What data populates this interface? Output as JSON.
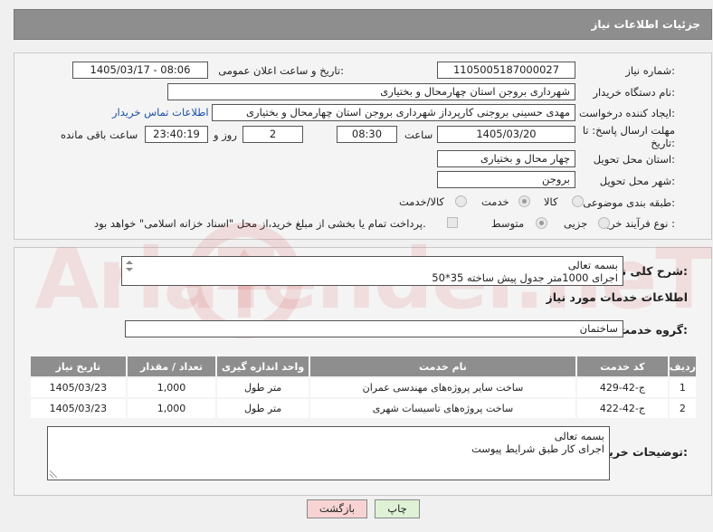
{
  "header": {
    "title": "جزئیات اطلاعات نیاز"
  },
  "fields": {
    "need_number_label": "شماره نیاز:",
    "need_number": "1105005187000027",
    "announce_label": "تاریخ و ساعت اعلان عمومی:",
    "announce_value": "1405/03/17 - 08:06",
    "buyer_org_label": "نام دستگاه خریدار:",
    "buyer_org": "شهرداری بروجن استان چهارمحال و بختیاری",
    "requester_label": "ایجاد کننده درخواست:",
    "requester": "مهدی حسینی بروجنی کارپرداز شهرداری بروجن استان چهارمحال و بختیاری",
    "contact_link": "اطلاعات تماس خریدار",
    "deadline_label": "مهلت ارسال پاسخ: تا تاریخ:",
    "deadline_date": "1405/03/20",
    "time_label": "ساعت",
    "deadline_time": "08:30",
    "days_value": "2",
    "days_label": "روز و",
    "remaining_time": "23:40:19",
    "remaining_label": "ساعت باقی مانده",
    "province_label": "استان محل تحویل:",
    "province": "چهار محال و بختیاری",
    "city_label": "شهر محل تحویل:",
    "city": "بروجن",
    "category_label": "طبقه بندی موضوعی:",
    "category_options": [
      "کالا",
      "خدمت",
      "کالا/خدمت"
    ],
    "category_selected": "خدمت",
    "process_label": "نوع فرآیند خرید :",
    "process_options": [
      "جزیی",
      "متوسط"
    ],
    "process_selected": "متوسط",
    "payment_note": "پرداخت تمام یا بخشی از مبلغ خرید،از محل \"اسناد خزانه اسلامی\" خواهد بود."
  },
  "summary": {
    "label": "شرح کلی نیاز:",
    "line1": "بسمه تعالی",
    "line2": "اجرای 1000متر جدول پیش ساخته 35*50"
  },
  "services": {
    "title": "اطلاعات خدمات مورد نیاز",
    "group_label": "گروه خدمت:",
    "group_value": "ساختمان",
    "columns": [
      "ردیف",
      "کد خدمت",
      "نام خدمت",
      "واحد اندازه گیری",
      "تعداد / مقدار",
      "تاریخ نیاز"
    ],
    "rows": [
      {
        "index": "1",
        "code": "ج-42-429",
        "name": "ساخت سایر پروژه‌های مهندسی عمران",
        "unit": "متر طول",
        "qty": "1,000",
        "date": "1405/03/23"
      },
      {
        "index": "2",
        "code": "ج-42-422",
        "name": "ساخت پروژه‌های تاسیسات شهری",
        "unit": "متر طول",
        "qty": "1,000",
        "date": "1405/03/23"
      }
    ]
  },
  "buyer_notes": {
    "label": "توضیحات خریدار:",
    "line1": "بسمه تعالی",
    "line2": "اجرای کار طبق شرایط پیوست"
  },
  "buttons": {
    "print": "چاپ",
    "back": "بازگشت"
  },
  "watermark": {
    "text": "AriaTender.neT"
  },
  "colors": {
    "header_bg": "#8e8e8e",
    "link": "#1a4fa8",
    "back_btn": "#f7d3d3",
    "print_btn": "#dff2d6",
    "watermark": "#d74646"
  }
}
